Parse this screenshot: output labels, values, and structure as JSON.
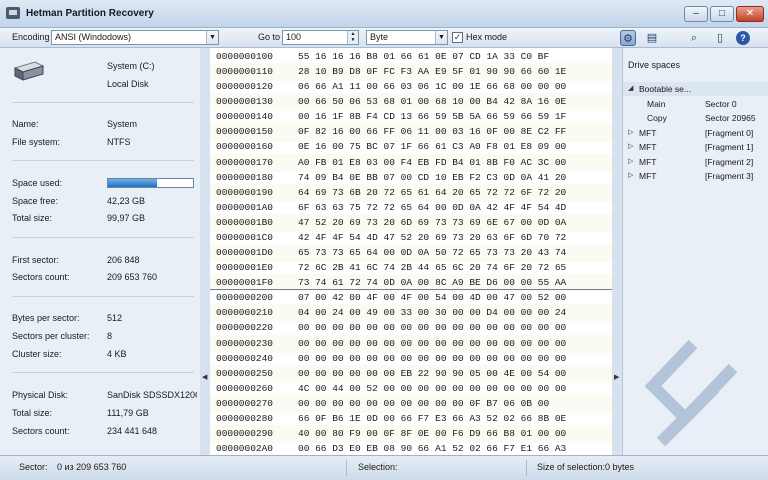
{
  "window": {
    "title": "Hetman Partition Recovery"
  },
  "toolbar": {
    "encoding_label": "Encoding",
    "encoding_value": "ANSI (Windodows)",
    "goto_label": "Go to",
    "goto_value": "100",
    "unit_value": "Byte",
    "hexmode_label": "Hex mode",
    "hexmode_checked": true
  },
  "left": {
    "disk_name": "System (C:)",
    "disk_type": "Local Disk",
    "name_label": "Name:",
    "name_value": "System",
    "fs_label": "File system:",
    "fs_value": "NTFS",
    "used_label": "Space used:",
    "used_fraction": 0.58,
    "free_label": "Space free:",
    "free_value": "42,23 GB",
    "total_label": "Total size:",
    "total_value": "99,97 GB",
    "first_label": "First sector:",
    "first_value": "206 848",
    "count_label": "Sectors count:",
    "count_value": "209 653 760",
    "bps_label": "Bytes per sector:",
    "bps_value": "512",
    "spc_label": "Sectors per cluster:",
    "spc_value": "8",
    "cs_label": "Cluster size:",
    "cs_value": "4 KB",
    "pd_label": "Physical Disk:",
    "pd_value": "SanDisk SDSSDX120GG",
    "ptotal_label": "Total size:",
    "ptotal_value": "111,79 GB",
    "pcount_label": "Sectors count:",
    "pcount_value": "234 441 648"
  },
  "hex": {
    "rows": [
      {
        "addr": "0000000100",
        "a": "55 16 16 16 B8 01 66",
        "b": "61 0E 07 CD 1A 33 C0 BF"
      },
      {
        "addr": "0000000110",
        "a": "28 10 B9 D8 0F FC F3 AA",
        "b": "E9 5F 01 90 90 66 60 1E"
      },
      {
        "addr": "0000000120",
        "a": "06 66 A1 11 00 66 03 06",
        "b": "1C 00 1E 66 68 00 00 00"
      },
      {
        "addr": "0000000130",
        "a": "00 66 50 06 53 68 01 00",
        "b": "68 10 00 B4 42 8A 16 0E"
      },
      {
        "addr": "0000000140",
        "a": "00 16 1F 8B F4 CD 13 66",
        "b": "59 5B 5A 66 59 66 59 1F"
      },
      {
        "addr": "0000000150",
        "a": "0F 82 16 00 66 FF 06 11",
        "b": "00 03 16 0F 00 8E C2 FF"
      },
      {
        "addr": "0000000160",
        "a": "0E 16 00 75 BC 07 1F 66",
        "b": "61 C3 A0 F8 01 E8 09 00"
      },
      {
        "addr": "0000000170",
        "a": "A0 FB 01 E8 03 00 F4 EB",
        "b": "FD B4 01 8B F0 AC 3C 00"
      },
      {
        "addr": "0000000180",
        "a": "74 09 B4 0E BB 07 00 CD",
        "b": "10 EB F2 C3 0D 0A 41 20"
      },
      {
        "addr": "0000000190",
        "a": "64 69 73 6B 20 72 65 61",
        "b": "64 20 65 72 72 6F 72 20"
      },
      {
        "addr": "00000001A0",
        "a": "6F 63 63 75 72 72 65 64",
        "b": "00 0D 0A 42 4F 4F 54 4D"
      },
      {
        "addr": "00000001B0",
        "a": "47 52 20 69 73 20 6D 69",
        "b": "73 73 69 6E 67 00 0D 0A"
      },
      {
        "addr": "00000001C0",
        "a": "42 4F 4F 54 4D 47 52 20",
        "b": "69 73 20 63 6F 6D 70 72"
      },
      {
        "addr": "00000001D0",
        "a": "65 73 73 65 64 00 0D 0A",
        "b": "50 72 65 73 73 20 43 74"
      },
      {
        "addr": "00000001E0",
        "a": "72 6C 2B 41 6C 74 2B 44",
        "b": "65 6C 20 74 6F 20 72 65"
      },
      {
        "addr": "00000001F0",
        "a": "73 74 61 72 74 0D 0A 00",
        "b": "8C A9 BE D6 00 00 55 AA"
      },
      {
        "addr": "0000000200",
        "a": "07 00 42 00 4F 00 4F 00",
        "b": "54 00 4D 00 47 00 52 00"
      },
      {
        "addr": "0000000210",
        "a": "04 00 24 00 49 00 33 00",
        "b": "30 00 00 D4 00 00 00 24"
      },
      {
        "addr": "0000000220",
        "a": "00 00 00 00 00 00 00 00",
        "b": "00 00 00 00 00 00 00 00"
      },
      {
        "addr": "0000000230",
        "a": "00 00 00 00 00 00 00 00",
        "b": "00 00 00 00 00 00 00 00"
      },
      {
        "addr": "0000000240",
        "a": "00 00 00 00 00 00 00 00",
        "b": "00 00 00 00 00 00 00 00"
      },
      {
        "addr": "0000000250",
        "a": "00 00 00 00 00 00 EB 22",
        "b": "90 90 05 00 4E 00 54 00"
      },
      {
        "addr": "0000000260",
        "a": "4C 00 44 00 52 00 00 00",
        "b": "00 00 00 00 00 00 00 00"
      },
      {
        "addr": "0000000270",
        "a": "00 00 00 00 00 00 00 00",
        "b": "00 00 0F B7 06 0B 00"
      },
      {
        "addr": "0000000280",
        "a": "66 0F B6 1E 0D 00 66 F7",
        "b": "E3 66 A3 52 02 66 8B 0E"
      },
      {
        "addr": "0000000290",
        "a": "40 00 80 F9 00 0F 8F 0E",
        "b": "00 F6 D9 66 B8 01 00 00"
      },
      {
        "addr": "00000002A0",
        "a": "00 66 D3 E0 EB 08 90 66",
        "b": "A1 52 02 66 F7 E1 66 A3"
      }
    ]
  },
  "right": {
    "title": "Drive spaces",
    "tree": [
      {
        "k": "Bootable se...",
        "v": "",
        "indent": 1,
        "twisty": "◢",
        "bold": false
      },
      {
        "k": "Main",
        "v": "Sector 0",
        "indent": 2,
        "twisty": "",
        "bold": false
      },
      {
        "k": "Copy",
        "v": "Sector 20965",
        "indent": 2,
        "twisty": "",
        "bold": false
      },
      {
        "k": "MFT",
        "v": "[Fragment 0]",
        "indent": 1,
        "twisty": "▷",
        "bold": false
      },
      {
        "k": "MFT",
        "v": "[Fragment 1]",
        "indent": 1,
        "twisty": "▷",
        "bold": false
      },
      {
        "k": "MFT",
        "v": "[Fragment 2]",
        "indent": 1,
        "twisty": "▷",
        "bold": false
      },
      {
        "k": "MFT",
        "v": "[Fragment 3]",
        "indent": 1,
        "twisty": "▷",
        "bold": false
      }
    ]
  },
  "status": {
    "sector_label": "Sector:",
    "sector_value": "0 из 209 653 760",
    "selection_label": "Selection:",
    "size_label": "Size of selection:",
    "size_value": "0 bytes"
  }
}
